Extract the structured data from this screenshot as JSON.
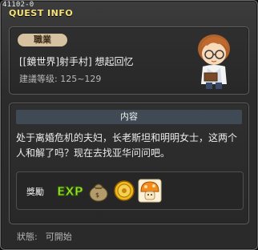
{
  "window": {
    "quest_id": "41102-0",
    "title": "QUEST INFO"
  },
  "quest": {
    "job_label": "職業",
    "name": "[[鏡世界]射手村] 想起回忆",
    "level_label": "建議等级:",
    "level_range": "125~129",
    "npc_icon": "npc-boy-with-glasses"
  },
  "content": {
    "header": "内容",
    "description": "处于离婚危机的夫妇，长老斯坦和明明女士，这两个人和解了吗？现在去找亚华问问吧。"
  },
  "reward": {
    "label": "獎勵",
    "items": [
      "exp-icon",
      "money-bag-icon",
      "coin-icon",
      "orange-mushroom-icon"
    ]
  },
  "status": {
    "label": "狀態:",
    "value": "可開始"
  },
  "colors": {
    "title": "#f6e27a",
    "job_pill": "#d6c1a0",
    "content_bar": "#3f4a55"
  }
}
